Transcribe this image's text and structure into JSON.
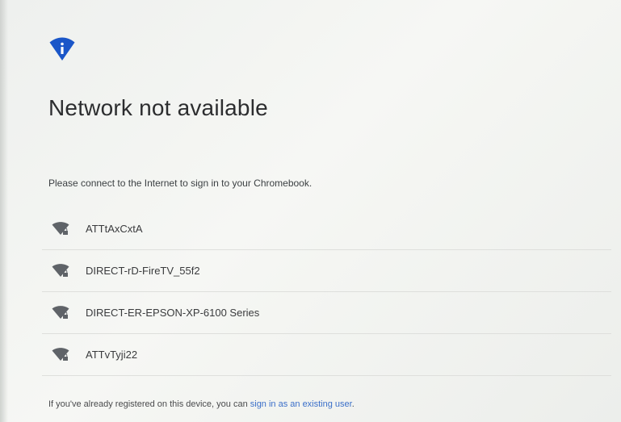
{
  "header": {
    "icon": "info-icon",
    "title": "Network not available",
    "subtitle": "Please connect to the Internet to sign in to your Chromebook."
  },
  "networks": [
    {
      "ssid": "ATTtAxCxtA",
      "icon": "wifi-locked-icon"
    },
    {
      "ssid": "DIRECT-rD-FireTV_55f2",
      "icon": "wifi-locked-icon"
    },
    {
      "ssid": "DIRECT-ER-EPSON-XP-6100 Series",
      "icon": "wifi-locked-icon"
    },
    {
      "ssid": "ATTvTyji22",
      "icon": "wifi-locked-icon"
    }
  ],
  "footer": {
    "text": "If you've already registered on this device, you can ",
    "link": "sign in as an existing user",
    "suffix": "."
  },
  "colors": {
    "accent": "#1a56c8",
    "link": "#3b6fc9",
    "wifi_icon": "#5f6368"
  }
}
